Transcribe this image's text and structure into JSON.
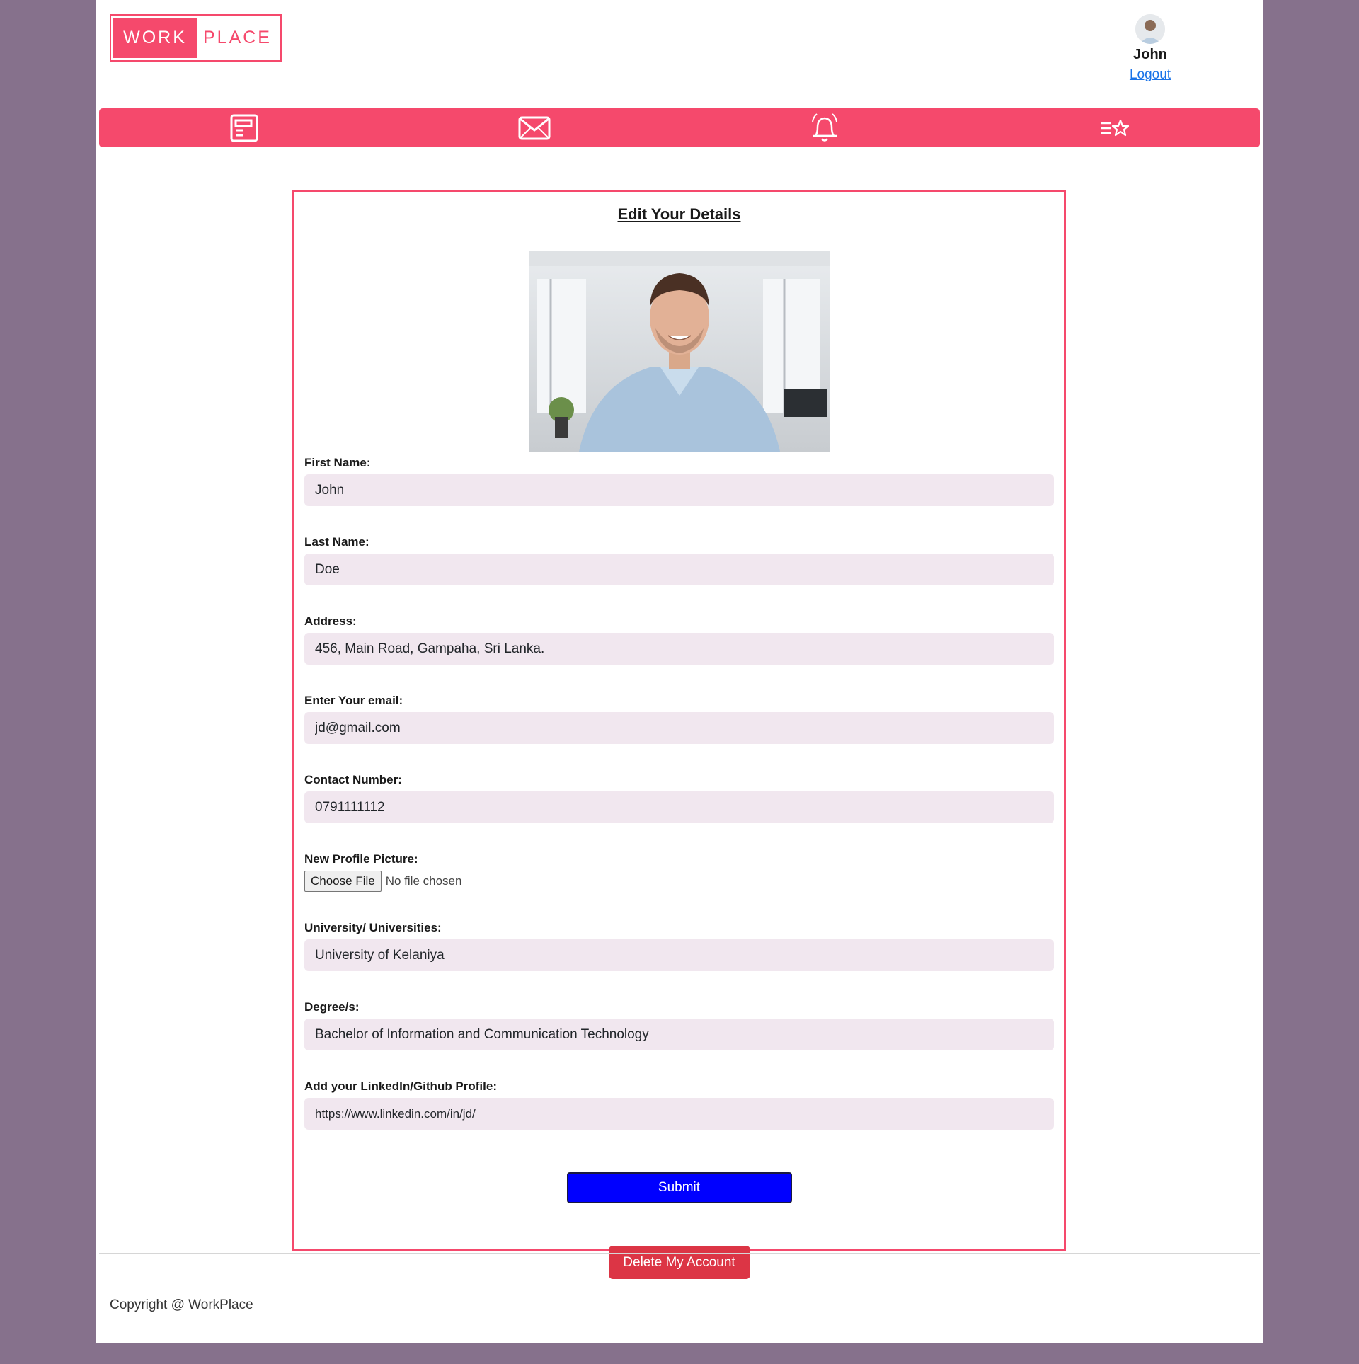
{
  "brand": {
    "logo_left": "WORK",
    "logo_right": "PLACE",
    "accent": "#f5496c"
  },
  "user": {
    "name": "John",
    "logout_label": "Logout",
    "avatar_icon": "user-avatar"
  },
  "nav": {
    "items": [
      {
        "icon": "document-icon"
      },
      {
        "icon": "mail-icon"
      },
      {
        "icon": "bell-icon"
      },
      {
        "icon": "starred-list-icon"
      }
    ]
  },
  "form": {
    "title": "Edit Your Details",
    "fields": {
      "first_name": {
        "label": "First Name:",
        "value": "John"
      },
      "last_name": {
        "label": "Last Name:",
        "value": "Doe"
      },
      "address": {
        "label": "Address:",
        "value": "456, Main Road, Gampaha, Sri Lanka."
      },
      "email": {
        "label": "Enter Your email:",
        "value": "jd@gmail.com"
      },
      "contact": {
        "label": "Contact Number:",
        "value": "0791111112"
      },
      "picture": {
        "label": "New Profile Picture:",
        "button": "Choose File",
        "status": "No file chosen"
      },
      "university": {
        "label": "University/ Universities:",
        "value": "University of Kelaniya"
      },
      "degree": {
        "label": "Degree/s:",
        "value": "Bachelor of Information and Communication Technology"
      },
      "profile_link": {
        "label": "Add your LinkedIn/Github Profile:",
        "value": "https://www.linkedin.com/in/jd/"
      }
    },
    "submit_label": "Submit",
    "delete_label": "Delete My Account"
  },
  "footer": {
    "copyright": "Copyright @ WorkPlace"
  }
}
